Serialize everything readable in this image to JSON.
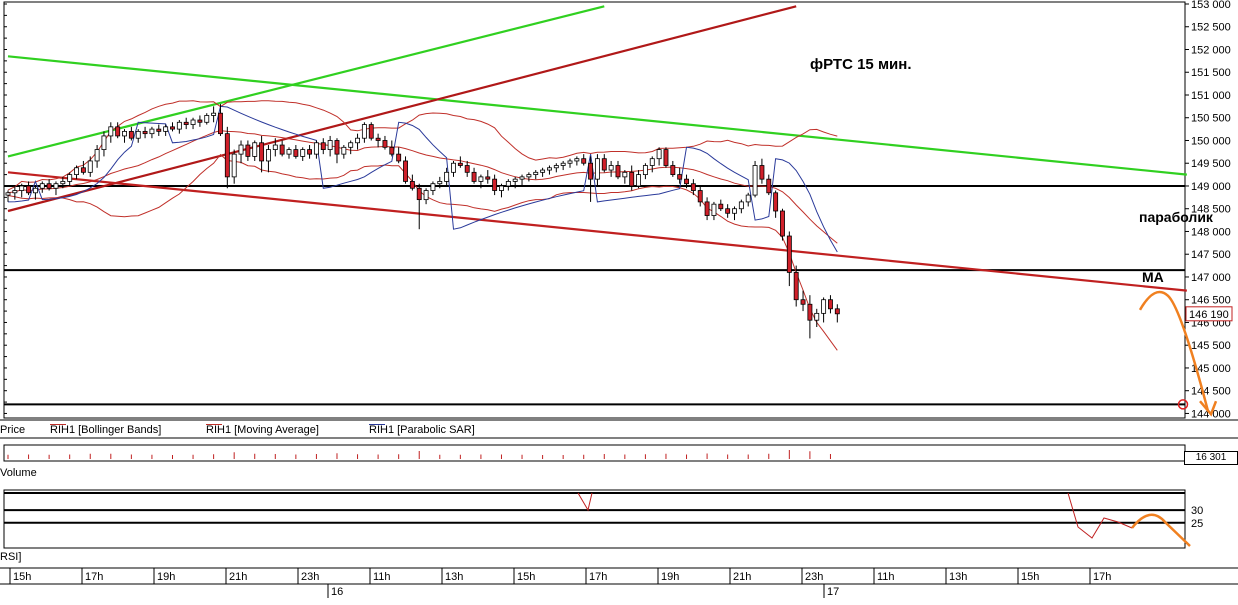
{
  "chart_data": {
    "type": "candlestick",
    "title": "фРТС  15 мин.",
    "annotations": {
      "parabolic": "параболик",
      "ma": "MA"
    },
    "price_axis": {
      "ticks": [
        "153 000",
        "152 500",
        "152 000",
        "151 500",
        "151 000",
        "150 500",
        "150 000",
        "149 500",
        "149 000",
        "148 500",
        "148 000",
        "147 500",
        "147 000",
        "146 500",
        "146 000",
        "145 500",
        "145 000",
        "144 500",
        "144 000"
      ],
      "range": [
        143900,
        153000
      ],
      "current_price": "146 190",
      "current_value": 146190
    },
    "legend": [
      {
        "label": "Price",
        "color": "#000000"
      },
      {
        "label": "RIH1 [Bollinger Bands]",
        "color": "#c0302a"
      },
      {
        "label": "RIH1 [Moving Average]",
        "color": "#c0302a"
      },
      {
        "label": "RIH1 [Parabolic SAR]",
        "color": "#2a3a9a"
      }
    ],
    "volume": {
      "label": "Volume",
      "current": "16 301"
    },
    "rsi": {
      "label": "RSI]",
      "ticks": [
        "30",
        "25"
      ],
      "levels": [
        30,
        25
      ]
    },
    "time_axis": {
      "hours": [
        "15h",
        "17h",
        "19h",
        "21h",
        "23h",
        "11h",
        "13h",
        "15h",
        "17h",
        "19h",
        "21h",
        "23h",
        "11h",
        "13h",
        "15h",
        "17h"
      ],
      "days": [
        "16",
        "17"
      ]
    },
    "candles": [
      [
        148800,
        148900,
        148650,
        148850
      ],
      [
        148850,
        149000,
        148700,
        148900
      ],
      [
        148900,
        149050,
        148750,
        149000
      ],
      [
        149000,
        149100,
        148800,
        148850
      ],
      [
        148850,
        149000,
        148700,
        148950
      ],
      [
        148950,
        149100,
        148850,
        149050
      ],
      [
        149050,
        149150,
        148900,
        148950
      ],
      [
        148950,
        149100,
        148800,
        149050
      ],
      [
        149050,
        149200,
        148950,
        149100
      ],
      [
        149100,
        149300,
        149000,
        149250
      ],
      [
        149250,
        149450,
        149150,
        149400
      ],
      [
        149400,
        149550,
        149250,
        149300
      ],
      [
        149300,
        149650,
        149200,
        149550
      ],
      [
        149550,
        149900,
        149400,
        149800
      ],
      [
        149800,
        150200,
        149650,
        150100
      ],
      [
        150100,
        150400,
        149950,
        150300
      ],
      [
        150300,
        150400,
        150050,
        150100
      ],
      [
        150100,
        150250,
        149950,
        150200
      ],
      [
        150200,
        150300,
        150000,
        150050
      ],
      [
        150050,
        150250,
        149950,
        150200
      ],
      [
        150200,
        150300,
        150050,
        150150
      ],
      [
        150150,
        150300,
        150050,
        150250
      ],
      [
        150250,
        150350,
        150100,
        150200
      ],
      [
        150200,
        150350,
        150100,
        150300
      ],
      [
        150300,
        150400,
        150200,
        150250
      ],
      [
        150250,
        150450,
        150150,
        150400
      ],
      [
        150400,
        150500,
        150250,
        150350
      ],
      [
        150350,
        150500,
        150250,
        150450
      ],
      [
        150450,
        150550,
        150300,
        150400
      ],
      [
        150400,
        150600,
        150350,
        150550
      ],
      [
        150550,
        150750,
        150400,
        150600
      ],
      [
        150600,
        150800,
        150100,
        150150
      ],
      [
        150150,
        150300,
        148950,
        149200
      ],
      [
        149200,
        149800,
        149050,
        149700
      ],
      [
        149700,
        150000,
        149500,
        149900
      ],
      [
        149900,
        150000,
        149550,
        149650
      ],
      [
        149650,
        150000,
        149550,
        149950
      ],
      [
        149950,
        150100,
        149300,
        149550
      ],
      [
        149550,
        149900,
        149300,
        149800
      ],
      [
        149800,
        150050,
        149650,
        149900
      ],
      [
        149900,
        150000,
        149650,
        149700
      ],
      [
        149700,
        149850,
        149600,
        149800
      ],
      [
        149800,
        149900,
        149600,
        149650
      ],
      [
        149650,
        149850,
        149550,
        149800
      ],
      [
        149800,
        149900,
        149600,
        149700
      ],
      [
        149700,
        150000,
        149600,
        149950
      ],
      [
        149950,
        150050,
        149700,
        149800
      ],
      [
        149800,
        150100,
        149650,
        150000
      ],
      [
        150000,
        150050,
        149500,
        149700
      ],
      [
        149700,
        149900,
        149600,
        149850
      ],
      [
        149850,
        150000,
        149700,
        149950
      ],
      [
        149950,
        150150,
        149800,
        150050
      ],
      [
        150050,
        150400,
        149950,
        150350
      ],
      [
        150350,
        150400,
        150000,
        150050
      ],
      [
        150050,
        150150,
        149850,
        150000
      ],
      [
        150000,
        150100,
        149800,
        149850
      ],
      [
        149850,
        150000,
        149650,
        149700
      ],
      [
        149700,
        149850,
        149500,
        149550
      ],
      [
        149550,
        149650,
        149050,
        149100
      ],
      [
        149100,
        149250,
        148900,
        148950
      ],
      [
        148950,
        149050,
        148050,
        148700
      ],
      [
        148700,
        148950,
        148600,
        148900
      ],
      [
        148900,
        149100,
        148800,
        149050
      ],
      [
        149050,
        149200,
        148950,
        149100
      ],
      [
        149100,
        149400,
        149000,
        149300
      ],
      [
        149300,
        149550,
        149200,
        149500
      ],
      [
        149500,
        149650,
        149400,
        149450
      ],
      [
        149450,
        149550,
        149200,
        149300
      ],
      [
        149300,
        149400,
        149050,
        149100
      ],
      [
        149100,
        149250,
        148950,
        149200
      ],
      [
        149200,
        149350,
        149050,
        149150
      ],
      [
        149150,
        149250,
        148800,
        148900
      ],
      [
        148900,
        149050,
        148750,
        149000
      ],
      [
        149000,
        149150,
        148900,
        149100
      ],
      [
        149100,
        149200,
        148950,
        149150
      ],
      [
        149150,
        149250,
        149000,
        149200
      ],
      [
        149200,
        149300,
        149100,
        149250
      ],
      [
        149250,
        149350,
        149150,
        149300
      ],
      [
        149300,
        149400,
        149200,
        149350
      ],
      [
        149350,
        149450,
        149250,
        149400
      ],
      [
        149400,
        149500,
        149300,
        149450
      ],
      [
        149450,
        149550,
        149350,
        149500
      ],
      [
        149500,
        149600,
        149400,
        149550
      ],
      [
        149550,
        149650,
        149450,
        149600
      ],
      [
        149600,
        149700,
        149450,
        149500
      ],
      [
        149500,
        149650,
        148650,
        149150
      ],
      [
        149150,
        149700,
        149000,
        149600
      ],
      [
        149600,
        149700,
        149300,
        149350
      ],
      [
        149350,
        149550,
        149200,
        149450
      ],
      [
        149450,
        149550,
        149150,
        149200
      ],
      [
        149200,
        149350,
        149050,
        149300
      ],
      [
        149300,
        149450,
        148900,
        149000
      ],
      [
        149000,
        149350,
        148950,
        149250
      ],
      [
        149250,
        149500,
        149150,
        149450
      ],
      [
        149450,
        149650,
        149300,
        149600
      ],
      [
        149600,
        149850,
        149450,
        149800
      ],
      [
        149800,
        149850,
        149400,
        149450
      ],
      [
        149450,
        149550,
        149200,
        149250
      ],
      [
        149250,
        149400,
        149050,
        149150
      ],
      [
        149150,
        149250,
        148950,
        149050
      ],
      [
        149050,
        149150,
        148800,
        148900
      ],
      [
        148900,
        149000,
        148550,
        148650
      ],
      [
        148650,
        148750,
        148250,
        148350
      ],
      [
        148350,
        148650,
        148250,
        148600
      ],
      [
        148600,
        148700,
        148450,
        148500
      ],
      [
        148500,
        148600,
        148300,
        148400
      ],
      [
        148400,
        148550,
        148250,
        148500
      ],
      [
        148500,
        148700,
        148400,
        148650
      ],
      [
        148650,
        148850,
        148550,
        148800
      ],
      [
        148800,
        149550,
        148750,
        149450
      ],
      [
        149450,
        149600,
        149050,
        149150
      ],
      [
        149150,
        149250,
        148800,
        148850
      ],
      [
        148850,
        148900,
        148300,
        148450
      ],
      [
        148450,
        148500,
        147800,
        147900
      ],
      [
        147900,
        148000,
        146800,
        147100
      ],
      [
        147100,
        147250,
        146350,
        146500
      ],
      [
        146500,
        146700,
        146250,
        146400
      ],
      [
        146400,
        146600,
        145650,
        146050
      ],
      [
        146050,
        146300,
        145900,
        146200
      ],
      [
        146200,
        146550,
        146000,
        146500
      ],
      [
        146500,
        146600,
        146200,
        146300
      ],
      [
        146300,
        146400,
        146000,
        146190
      ]
    ],
    "trendlines": [
      {
        "color": "#30d020",
        "p1": [
          0,
          149650
        ],
        "p2": [
          87,
          152950
        ]
      },
      {
        "color": "#30d020",
        "p1": [
          0,
          151850
        ],
        "p2": [
          172,
          149250
        ]
      },
      {
        "color": "#b01818",
        "p1": [
          0,
          148450
        ],
        "p2": [
          115,
          152950
        ]
      },
      {
        "color": "#c02020",
        "p1": [
          0,
          149300
        ],
        "p2": [
          172,
          146700
        ]
      }
    ],
    "hlines": [
      149000,
      147150,
      144200
    ]
  }
}
